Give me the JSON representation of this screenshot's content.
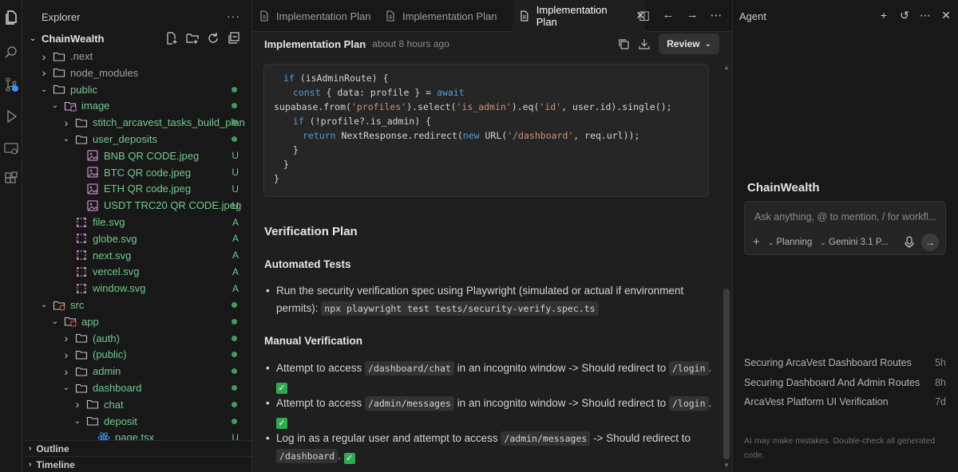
{
  "explorer": {
    "title": "Explorer",
    "more": "···",
    "root": "ChainWealth",
    "items": [
      {
        "label": ".next",
        "type": "folder",
        "depth": 1,
        "expanded": false,
        "color": "muted",
        "badge": "",
        "dot": false
      },
      {
        "label": "node_modules",
        "type": "folder",
        "depth": 1,
        "expanded": false,
        "color": "muted",
        "badge": "",
        "dot": false
      },
      {
        "label": "public",
        "type": "folder",
        "depth": 1,
        "expanded": true,
        "color": "green",
        "badge": "",
        "dot": true
      },
      {
        "label": "image",
        "type": "folder-image",
        "depth": 2,
        "expanded": true,
        "color": "green",
        "badge": "",
        "dot": true
      },
      {
        "label": "stitch_arcavest_tasks_build_plan",
        "type": "folder",
        "depth": 3,
        "expanded": false,
        "color": "green",
        "badge": "",
        "dot": true
      },
      {
        "label": "user_deposits",
        "type": "folder",
        "depth": 3,
        "expanded": true,
        "color": "green",
        "badge": "",
        "dot": true
      },
      {
        "label": "BNB QR CODE.jpeg",
        "type": "image",
        "depth": 4,
        "expanded": null,
        "color": "green",
        "badge": "U",
        "dot": false
      },
      {
        "label": "BTC QR code.jpeg",
        "type": "image",
        "depth": 4,
        "expanded": null,
        "color": "green",
        "badge": "U",
        "dot": false
      },
      {
        "label": "ETH QR code.jpeg",
        "type": "image",
        "depth": 4,
        "expanded": null,
        "color": "green",
        "badge": "U",
        "dot": false
      },
      {
        "label": "USDT TRC20 QR CODE.jpeg",
        "type": "image",
        "depth": 4,
        "expanded": null,
        "color": "green",
        "badge": "U",
        "dot": false
      },
      {
        "label": "file.svg",
        "type": "svg",
        "depth": 3,
        "expanded": null,
        "color": "green",
        "badge": "A",
        "dot": false
      },
      {
        "label": "globe.svg",
        "type": "svg",
        "depth": 3,
        "expanded": null,
        "color": "green",
        "badge": "A",
        "dot": false
      },
      {
        "label": "next.svg",
        "type": "svg",
        "depth": 3,
        "expanded": null,
        "color": "green",
        "badge": "A",
        "dot": false
      },
      {
        "label": "vercel.svg",
        "type": "svg",
        "depth": 3,
        "expanded": null,
        "color": "green",
        "badge": "A",
        "dot": false
      },
      {
        "label": "window.svg",
        "type": "svg",
        "depth": 3,
        "expanded": null,
        "color": "green",
        "badge": "A",
        "dot": false
      },
      {
        "label": "src",
        "type": "folder-src",
        "depth": 1,
        "expanded": true,
        "color": "green",
        "badge": "",
        "dot": true
      },
      {
        "label": "app",
        "type": "folder-app",
        "depth": 2,
        "expanded": true,
        "color": "green",
        "badge": "",
        "dot": true
      },
      {
        "label": "(auth)",
        "type": "folder",
        "depth": 3,
        "expanded": false,
        "color": "green",
        "badge": "",
        "dot": true
      },
      {
        "label": "(public)",
        "type": "folder",
        "depth": 3,
        "expanded": false,
        "color": "green",
        "badge": "",
        "dot": true
      },
      {
        "label": "admin",
        "type": "folder",
        "depth": 3,
        "expanded": false,
        "color": "green",
        "badge": "",
        "dot": true
      },
      {
        "label": "dashboard",
        "type": "folder",
        "depth": 3,
        "expanded": true,
        "color": "green",
        "badge": "",
        "dot": true
      },
      {
        "label": "chat",
        "type": "folder",
        "depth": 4,
        "expanded": false,
        "color": "green",
        "badge": "",
        "dot": true
      },
      {
        "label": "deposit",
        "type": "folder",
        "depth": 4,
        "expanded": true,
        "color": "green",
        "badge": "",
        "dot": true
      },
      {
        "label": "page.tsx",
        "type": "react",
        "depth": 5,
        "expanded": null,
        "color": "green",
        "badge": "U",
        "dot": false
      }
    ],
    "outline": "Outline",
    "timeline": "Timeline"
  },
  "tabs": [
    {
      "label": "Implementation Plan",
      "active": false
    },
    {
      "label": "Implementation Plan",
      "active": false
    },
    {
      "label": "Implementation Plan",
      "active": true
    }
  ],
  "doc": {
    "title": "Implementation Plan",
    "time": "about 8 hours ago",
    "review": "Review",
    "code": {
      "l1_kw": "if",
      "l1_rest": " (isAdminRoute) {",
      "l2_kw": "const",
      "l2_rest": " { data: profile } = ",
      "l2_kw2": "await",
      "l3_a": "supabase.from(",
      "l3_s1": "'profiles'",
      "l3_b": ").select(",
      "l3_s2": "'is_admin'",
      "l3_c": ").eq(",
      "l3_s3": "'id'",
      "l3_d": ", user.id).single();",
      "l4_kw": "if",
      "l4_rest": " (!profile?.is_admin) {",
      "l5_kw": "return",
      "l5_a": " NextResponse.redirect(",
      "l5_kw2": "new",
      "l5_b": " URL(",
      "l5_s": "'/dashboard'",
      "l5_c": ", req.url));",
      "l6": "}",
      "l7": "}",
      "l8": "}"
    },
    "verification_heading": "Verification Plan",
    "automated_heading": "Automated Tests",
    "automated_text_1": "Run the security verification spec using Playwright (simulated or actual if environment",
    "automated_text_2": "permits):",
    "automated_cmd": "npx playwright test tests/security-verify.spec.ts",
    "manual_heading": "Manual Verification",
    "m1_pre": "Attempt to access",
    "m1_code": "/dashboard/chat",
    "m1_mid": "in an incognito window -> Should redirect to",
    "m1_code2": "/login",
    "m2_pre": "Attempt to access",
    "m2_code": "/admin/messages",
    "m2_mid": "in an incognito window -> Should redirect to",
    "m2_code2": "/login",
    "m3_pre": "Log in as a regular user and attempt to access",
    "m3_code": "/admin/messages",
    "m3_mid": "-> Should redirect to",
    "m3_code2": "/dashboard",
    "check": "✓",
    "dot": "."
  },
  "agent": {
    "title": "Agent",
    "workspace": "ChainWealth",
    "placeholder": "Ask anything, @ to mention, / for workfl...",
    "mode": "Planning",
    "model": "Gemini 3.1 P...",
    "history": [
      {
        "title": "Securing ArcaVest Dashboard Routes",
        "time": "5h"
      },
      {
        "title": "Securing Dashboard And Admin Routes",
        "time": "8h"
      },
      {
        "title": "ArcaVest Platform UI Verification",
        "time": "7d"
      }
    ],
    "disclaimer": "AI may make mistakes. Double-check all generated code."
  },
  "colors": {
    "green_text": "#73c991",
    "badge_dot": "#4b9a5a",
    "check": "#33a852",
    "keyword": "#569cd6",
    "string": "#ce9178"
  }
}
